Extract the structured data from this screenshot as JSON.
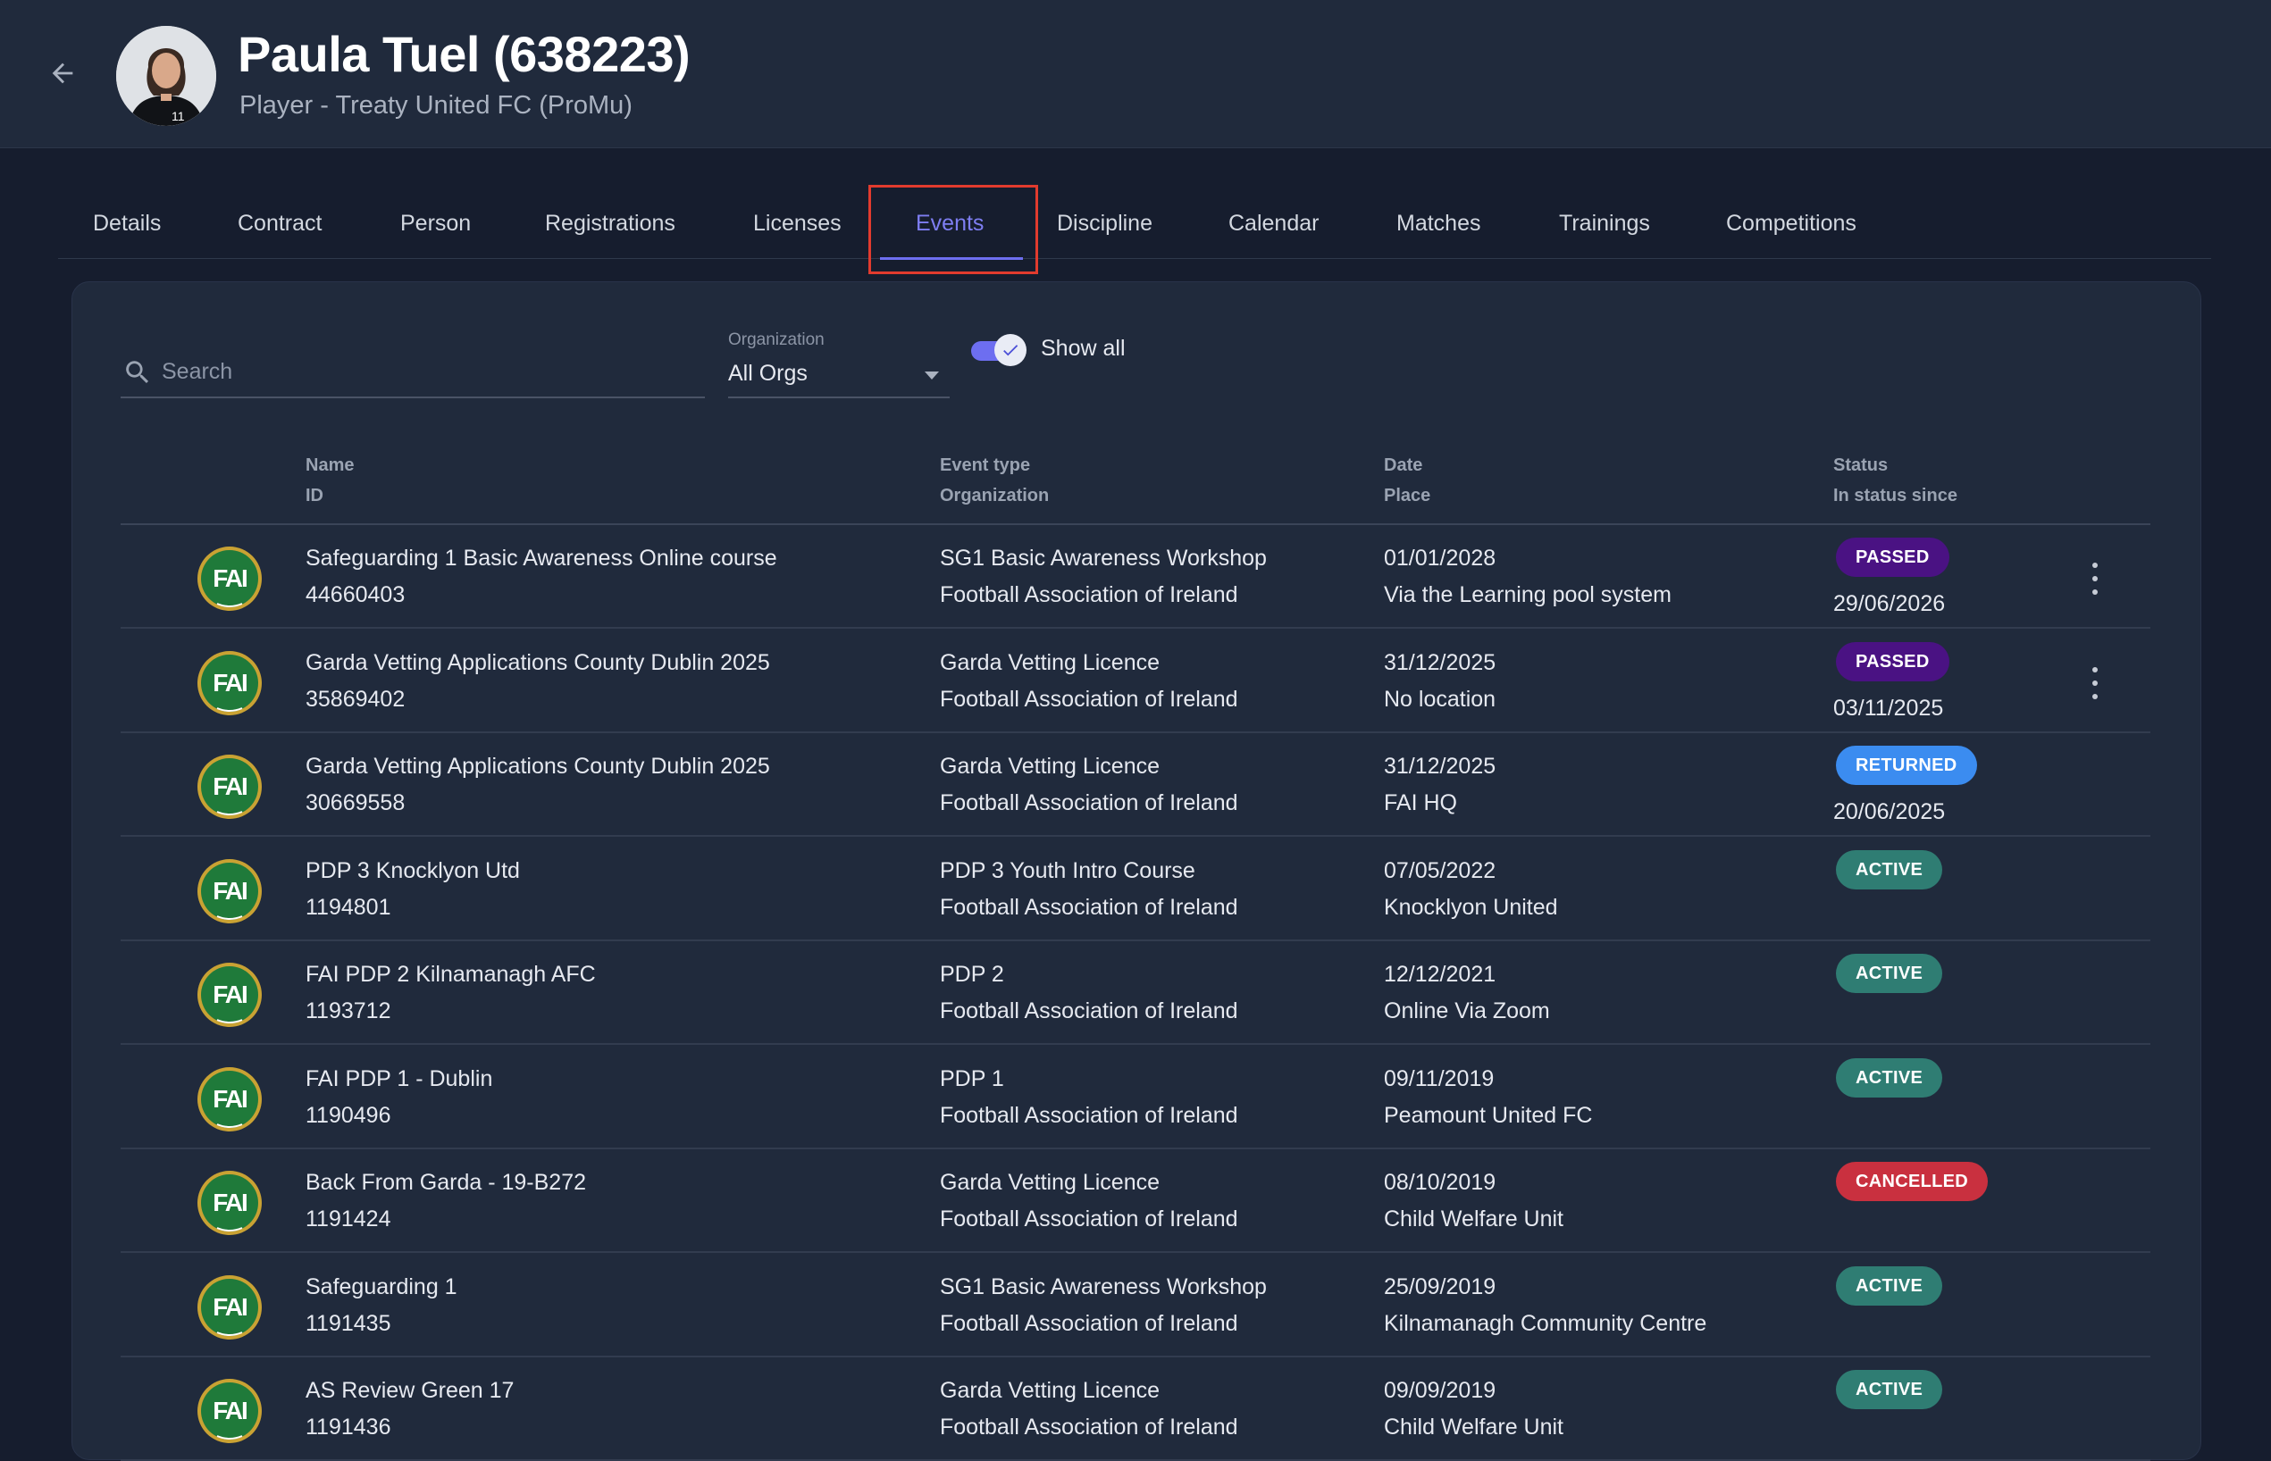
{
  "header": {
    "title": "Paula Tuel (638223)",
    "subtitle": "Player - Treaty United FC (ProMu)",
    "back_icon": "arrow-left-icon"
  },
  "tabs": [
    {
      "label": "Details"
    },
    {
      "label": "Contract"
    },
    {
      "label": "Person"
    },
    {
      "label": "Registrations"
    },
    {
      "label": "Licenses"
    },
    {
      "label": "Events",
      "active": true
    },
    {
      "label": "Discipline"
    },
    {
      "label": "Calendar"
    },
    {
      "label": "Matches"
    },
    {
      "label": "Trainings"
    },
    {
      "label": "Competitions"
    }
  ],
  "filters": {
    "search_placeholder": "Search",
    "organization_label": "Organization",
    "organization_value": "All Orgs",
    "show_all_label": "Show all",
    "show_all_checked": true
  },
  "columns": {
    "name": "Name",
    "id": "ID",
    "event_type": "Event type",
    "organization": "Organization",
    "date": "Date",
    "place": "Place",
    "status": "Status",
    "status_since": "In status since"
  },
  "logo_text": "FAI",
  "status_colors": {
    "PASSED": "#4a1283",
    "RETURNED": "#3b8cf0",
    "ACTIVE": "#2f7d73",
    "CANCELLED": "#c9303f"
  },
  "rows": [
    {
      "name": "Safeguarding 1 Basic Awareness Online course",
      "id": "44660403",
      "event_type": "SG1 Basic Awareness Workshop",
      "organization": "Football Association of Ireland",
      "date": "01/01/2028",
      "place": "Via the Learning pool system",
      "status": "PASSED",
      "since": "29/06/2026",
      "menu": true
    },
    {
      "name": "Garda Vetting Applications County Dublin 2025",
      "id": "35869402",
      "event_type": "Garda Vetting Licence",
      "organization": "Football Association of Ireland",
      "date": "31/12/2025",
      "place": "No location",
      "status": "PASSED",
      "since": "03/11/2025",
      "menu": true
    },
    {
      "name": "Garda Vetting Applications County Dublin 2025",
      "id": "30669558",
      "event_type": "Garda Vetting Licence",
      "organization": "Football Association of Ireland",
      "date": "31/12/2025",
      "place": "FAI HQ",
      "status": "RETURNED",
      "since": "20/06/2025",
      "menu": false
    },
    {
      "name": "PDP 3 Knocklyon Utd",
      "id": "1194801",
      "event_type": "PDP 3 Youth Intro Course",
      "organization": "Football Association of Ireland",
      "date": "07/05/2022",
      "place": "Knocklyon United",
      "status": "ACTIVE",
      "since": "",
      "menu": false
    },
    {
      "name": "FAI PDP 2 Kilnamanagh AFC",
      "id": "1193712",
      "event_type": "PDP 2",
      "organization": "Football Association of Ireland",
      "date": "12/12/2021",
      "place": "Online Via Zoom",
      "status": "ACTIVE",
      "since": "",
      "menu": false
    },
    {
      "name": "FAI PDP 1 - Dublin",
      "id": "1190496",
      "event_type": "PDP 1",
      "organization": "Football Association of Ireland",
      "date": "09/11/2019",
      "place": "Peamount United FC",
      "status": "ACTIVE",
      "since": "",
      "menu": false
    },
    {
      "name": "Back From Garda - 19-B272",
      "id": "1191424",
      "event_type": "Garda Vetting Licence",
      "organization": "Football Association of Ireland",
      "date": "08/10/2019",
      "place": "Child Welfare Unit",
      "status": "CANCELLED",
      "since": "",
      "menu": false
    },
    {
      "name": "Safeguarding 1",
      "id": "1191435",
      "event_type": "SG1 Basic Awareness Workshop",
      "organization": "Football Association of Ireland",
      "date": "25/09/2019",
      "place": "Kilnamanagh Community Centre",
      "status": "ACTIVE",
      "since": "",
      "menu": false
    },
    {
      "name": "AS Review Green 17",
      "id": "1191436",
      "event_type": "Garda Vetting Licence",
      "organization": "Football Association of Ireland",
      "date": "09/09/2019",
      "place": "Child Welfare Unit",
      "status": "ACTIVE",
      "since": "",
      "menu": false
    }
  ]
}
